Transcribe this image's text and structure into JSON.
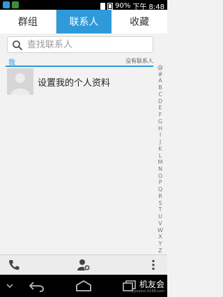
{
  "status_bar": {
    "battery": "90%",
    "time": "下午 8:48"
  },
  "tabs": [
    {
      "label": "群组",
      "active": false
    },
    {
      "label": "联系人",
      "active": true
    },
    {
      "label": "收藏",
      "active": false
    }
  ],
  "search": {
    "placeholder": "查找联系人"
  },
  "section": {
    "label": "我",
    "note": "没有联系人"
  },
  "profile": {
    "label": "设置我的个人资料"
  },
  "index_letters": [
    "@",
    "#",
    "A",
    "B",
    "C",
    "D",
    "E",
    "F",
    "G",
    "H",
    "I",
    "J",
    "K",
    "L",
    "M",
    "N",
    "O",
    "P",
    "Q",
    "R",
    "S",
    "T",
    "U",
    "V",
    "W",
    "X",
    "Y",
    "Z"
  ],
  "bottom_actions": {
    "phone_icon": "phone-icon",
    "add_contact_icon": "add-contact-icon",
    "menu_icon": "overflow-menu-icon"
  },
  "watermark": {
    "brand": "机友会",
    "url": "jiyouhui.it168.com"
  },
  "colors": {
    "accent": "#2f9ad9",
    "bg": "#f2f2f2"
  }
}
